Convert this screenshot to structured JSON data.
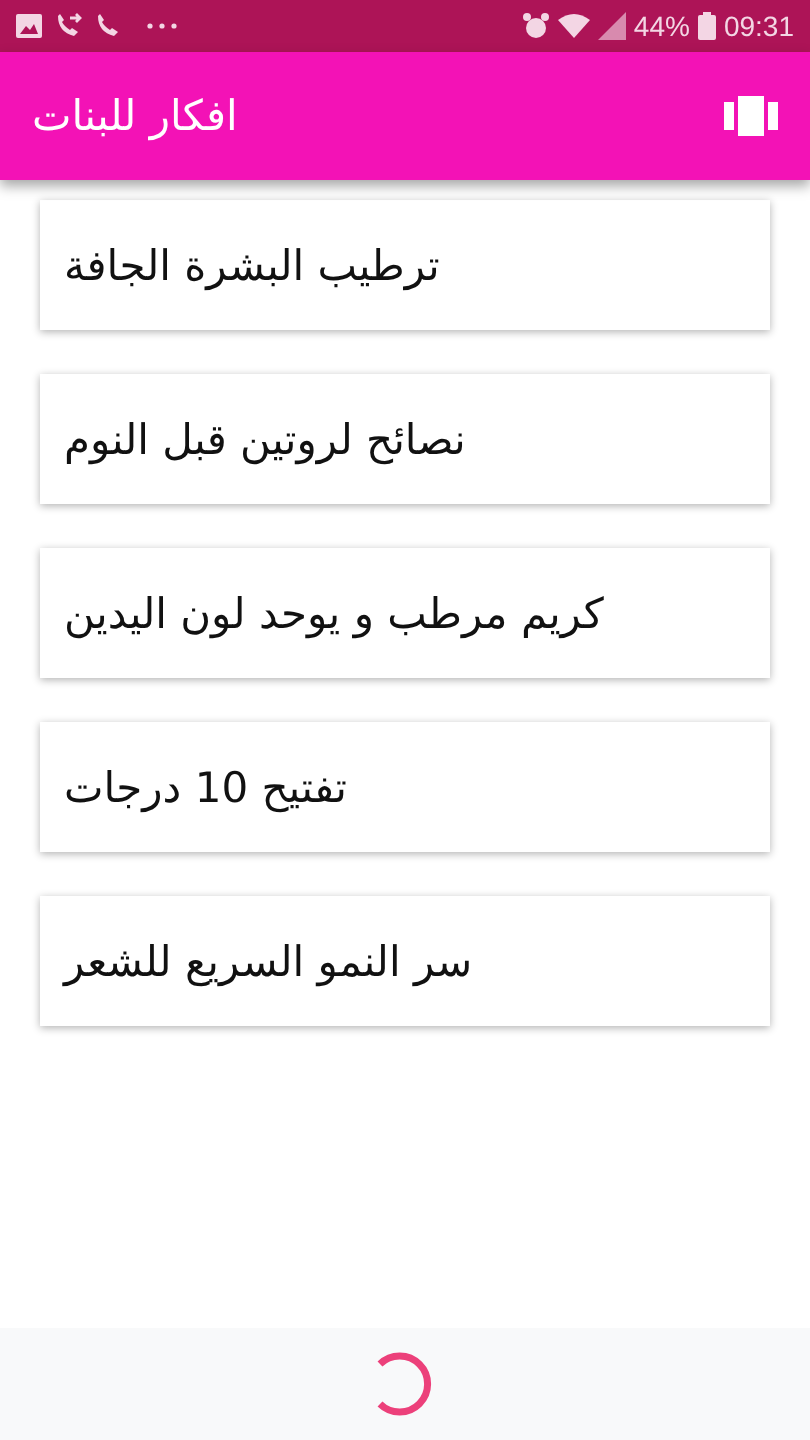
{
  "status_bar": {
    "battery": "44%",
    "time": "09:31"
  },
  "app_bar": {
    "title": "افكار للبنات"
  },
  "topics": [
    {
      "title": "ترطيب البشرة الجافة"
    },
    {
      "title": "نصائح لروتين قبل النوم"
    },
    {
      "title": "كريم مرطب و يوحد لون اليدين"
    },
    {
      "title": "تفتيح 10 درجات"
    },
    {
      "title": "سر النمو السريع للشعر"
    }
  ]
}
